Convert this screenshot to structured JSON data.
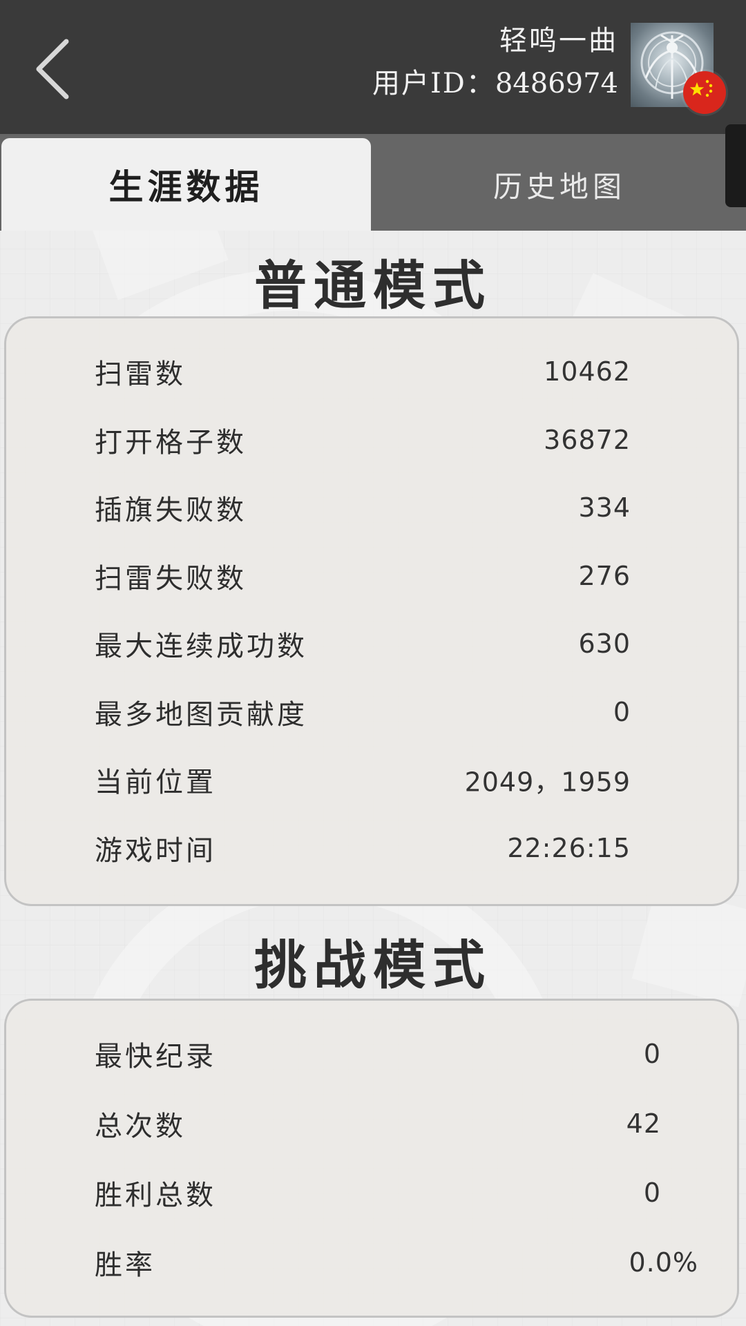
{
  "header": {
    "username": "轻鸣一曲",
    "user_id_label": "用户ID",
    "user_id_separator": "：",
    "user_id": "8486974",
    "avatar_icon": "warrior-emblem-avatar",
    "flag_icon": "china-flag-icon",
    "back_icon": "chevron-left-icon"
  },
  "tabs": [
    {
      "label": "生涯数据",
      "active": true
    },
    {
      "label": "历史地图",
      "active": false
    }
  ],
  "normal_mode": {
    "title": "普通模式",
    "stats": [
      {
        "label": "扫雷数",
        "value": "10462"
      },
      {
        "label": "打开格子数",
        "value": "36872"
      },
      {
        "label": "插旗失败数",
        "value": "334"
      },
      {
        "label": "扫雷失败数",
        "value": "276"
      },
      {
        "label": "最大连续成功数",
        "value": "630"
      },
      {
        "label": "最多地图贡献度",
        "value": "0"
      },
      {
        "label": "当前位置",
        "value": "2049，1959"
      },
      {
        "label": "游戏时间",
        "value": "22:26:15"
      }
    ]
  },
  "challenge_mode": {
    "title": "挑战模式",
    "stats": [
      {
        "label": "最快纪录",
        "value": "0"
      },
      {
        "label": "总次数",
        "value": "42"
      },
      {
        "label": "胜利总数",
        "value": "0"
      },
      {
        "label": "胜率",
        "value": "0.0%"
      }
    ]
  },
  "colors": {
    "header_bg": "#3a3a3a",
    "tab_bar_bg": "#666666",
    "active_tab_bg": "#f0f0f0",
    "page_bg": "#ececec",
    "flag_red": "#d9261c",
    "flag_star": "#ffde00"
  }
}
